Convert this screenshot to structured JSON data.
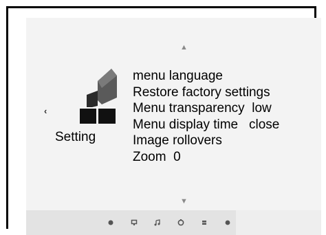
{
  "nav": {
    "up_arrow": "▲",
    "down_arrow": "▼",
    "left_arrow": "‹"
  },
  "category": {
    "label": "Setting",
    "icon": "setting-tiles-icon"
  },
  "menu": {
    "items": [
      {
        "label": "menu language",
        "value": ""
      },
      {
        "label": "Restore factory settings",
        "value": ""
      },
      {
        "label": "Menu transparency",
        "value": "low"
      },
      {
        "label": "Menu display time",
        "value": "close"
      },
      {
        "label": "Image rollovers",
        "value": ""
      },
      {
        "label": "Zoom",
        "value": "0"
      }
    ]
  },
  "bottom_bar": {
    "icons": [
      "photo-icon",
      "video-icon",
      "music-icon",
      "clock-icon",
      "text-icon",
      "setting-icon"
    ]
  },
  "colors": {
    "frame_border": "#000000",
    "screen_bg": "#f3f3f3",
    "bar_bg": "#e3e3e3",
    "text": "#000000",
    "arrow": "#8a8a8a"
  }
}
